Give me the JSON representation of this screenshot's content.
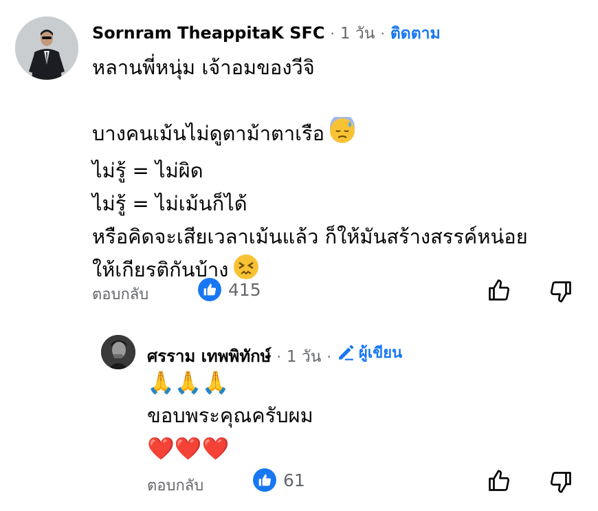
{
  "colors": {
    "accent": "#1877f2",
    "secondary_text": "#65676b",
    "primary_text": "#050505"
  },
  "comment": {
    "author": "Sornram TheappitaK SFC",
    "time": "1 วัน",
    "separator": "·",
    "follow_label": "ติดตาม",
    "lines": [
      "หลานพี่หนุ่ม  เจ้าอมของวีจิ",
      "",
      "บางคนเม้นไม่ดูตาม้าตาเรือ",
      "ไม่รู้ = ไม่ผิด",
      "ไม่รู้ = ไม่เม้นก็ได้",
      "หรือคิดจะเสียเวลาเม้นแล้ว ก็ให้มันสร้างสรรค์หน่อย",
      "ให้เกียรติกันบ้าง"
    ],
    "emojis": {
      "line3": "downcast-sweat-emoji",
      "line7": "persevering-face-emoji"
    },
    "reply_label": "ตอบกลับ",
    "like_count": "415",
    "icons": {
      "like": "thumbs-up-icon",
      "dislike": "thumbs-down-icon",
      "reaction": "like-reaction-icon"
    }
  },
  "reply": {
    "author": "ศรราม เทพพิทักษ์",
    "time": "1 วัน",
    "separator": "·",
    "badge_label": "ผู้เขียน",
    "badge_icon": "pencil-icon",
    "lines": [
      "🙏🙏🙏",
      "ขอบพระคุณครับผม",
      "❤️❤️❤️"
    ],
    "reply_label": "ตอบกลับ",
    "like_count": "61"
  }
}
